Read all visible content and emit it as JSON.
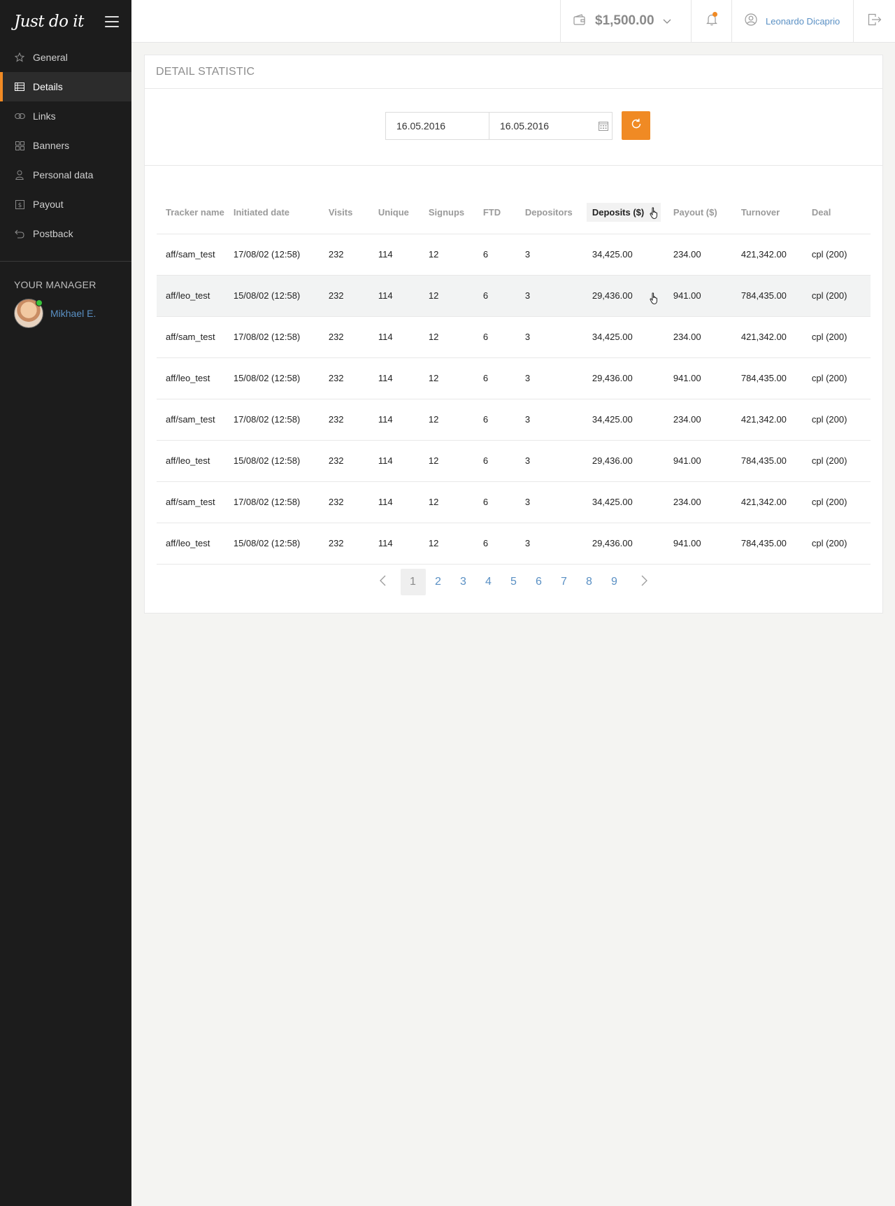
{
  "brand": {
    "logo": "Just do it"
  },
  "sidebar": {
    "items": [
      {
        "label": "General",
        "icon": "star-icon",
        "active": false
      },
      {
        "label": "Details",
        "icon": "list-icon",
        "active": true
      },
      {
        "label": "Links",
        "icon": "link-icon",
        "active": false
      },
      {
        "label": "Banners",
        "icon": "grid-icon",
        "active": false
      },
      {
        "label": "Personal data",
        "icon": "person-icon",
        "active": false
      },
      {
        "label": "Payout",
        "icon": "dollar-icon",
        "active": false
      },
      {
        "label": "Postback",
        "icon": "undo-icon",
        "active": false
      }
    ],
    "manager_title": "YOUR MANAGER",
    "manager_name": "Mikhael E."
  },
  "topbar": {
    "balance": "$1,500.00",
    "user_name": "Leonardo Dicaprio"
  },
  "page": {
    "title": "DETAIL STATISTIC",
    "date_from": "16.05.2016",
    "date_to": "16.05.2016"
  },
  "table": {
    "columns": [
      "Tracker name",
      "Initiated date",
      "Visits",
      "Unique",
      "Signups",
      "FTD",
      "Depositors",
      "Deposits ($)",
      "Payout ($)",
      "Turnover",
      "Deal"
    ],
    "sorted_column": 7,
    "rows": [
      [
        "aff/sam_test",
        "17/08/02 (12:58)",
        "232",
        "114",
        "12",
        "6",
        "3",
        "34,425.00",
        "234.00",
        "421,342.00",
        "cpl (200)"
      ],
      [
        "aff/leo_test",
        "15/08/02 (12:58)",
        "232",
        "114",
        "12",
        "6",
        "3",
        "29,436.00",
        "941.00",
        "784,435.00",
        "cpl (200)"
      ],
      [
        "aff/sam_test",
        "17/08/02 (12:58)",
        "232",
        "114",
        "12",
        "6",
        "3",
        "34,425.00",
        "234.00",
        "421,342.00",
        "cpl (200)"
      ],
      [
        "aff/leo_test",
        "15/08/02 (12:58)",
        "232",
        "114",
        "12",
        "6",
        "3",
        "29,436.00",
        "941.00",
        "784,435.00",
        "cpl (200)"
      ],
      [
        "aff/sam_test",
        "17/08/02 (12:58)",
        "232",
        "114",
        "12",
        "6",
        "3",
        "34,425.00",
        "234.00",
        "421,342.00",
        "cpl (200)"
      ],
      [
        "aff/leo_test",
        "15/08/02 (12:58)",
        "232",
        "114",
        "12",
        "6",
        "3",
        "29,436.00",
        "941.00",
        "784,435.00",
        "cpl (200)"
      ],
      [
        "aff/sam_test",
        "17/08/02 (12:58)",
        "232",
        "114",
        "12",
        "6",
        "3",
        "34,425.00",
        "234.00",
        "421,342.00",
        "cpl (200)"
      ],
      [
        "aff/leo_test",
        "15/08/02 (12:58)",
        "232",
        "114",
        "12",
        "6",
        "3",
        "29,436.00",
        "941.00",
        "784,435.00",
        "cpl (200)"
      ]
    ],
    "highlighted_row": 1
  },
  "pagination": {
    "pages": [
      "1",
      "2",
      "3",
      "4",
      "5",
      "6",
      "7",
      "8",
      "9"
    ],
    "current": "1"
  },
  "colors": {
    "accent": "#f08a24",
    "sidebar_bg": "#1c1c1c",
    "link": "#5a90c4",
    "online": "#38c43a"
  }
}
